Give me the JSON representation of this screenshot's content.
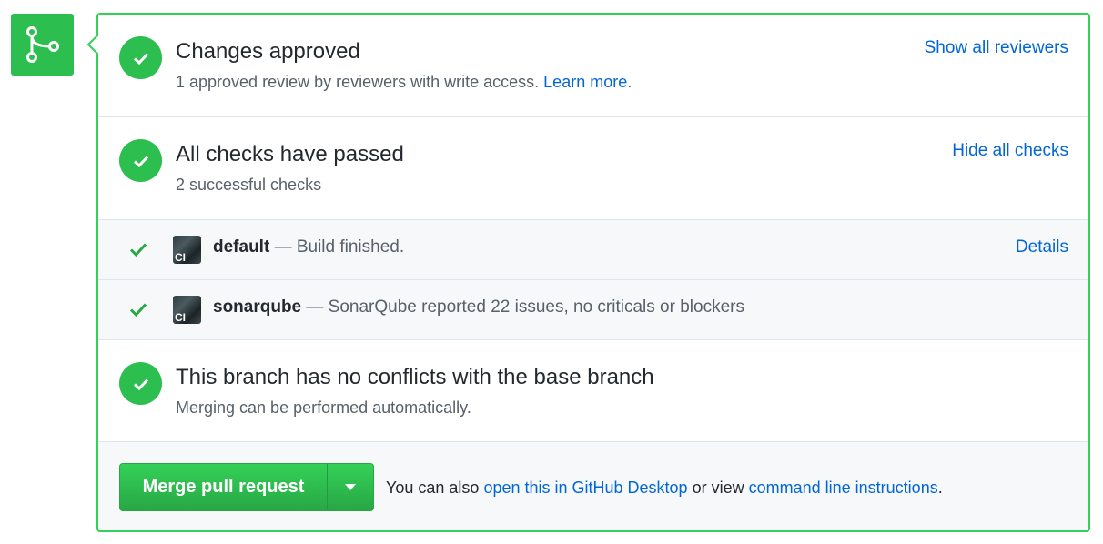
{
  "approved": {
    "title": "Changes approved",
    "subtext": "1 approved review by reviewers with write access.",
    "learn_more": "Learn more.",
    "show_reviewers": "Show all reviewers"
  },
  "checks": {
    "title": "All checks have passed",
    "subtext": "2 successful checks",
    "hide_checks": "Hide all checks",
    "items": [
      {
        "avatar_text": "CI",
        "name": "default",
        "description": "— Build finished.",
        "details": "Details"
      },
      {
        "avatar_text": "CI",
        "name": "sonarqube",
        "description": "— SonarQube reported 22 issues, no criticals or blockers"
      }
    ]
  },
  "conflicts": {
    "title": "This branch has no conflicts with the base branch",
    "subtext": "Merging can be performed automatically."
  },
  "merge": {
    "button_label": "Merge pull request",
    "note_prefix": "You can also",
    "desktop_link": "open this in GitHub Desktop",
    "note_middle": "or view",
    "cli_link": "command line instructions",
    "note_suffix": "."
  },
  "icons": {
    "badge": "git-merge-icon",
    "status": "check-icon",
    "dropdown": "triangle-down-icon"
  },
  "colors": {
    "success": "#2cbe4e",
    "border": "#34d058",
    "link": "#0366d6"
  }
}
